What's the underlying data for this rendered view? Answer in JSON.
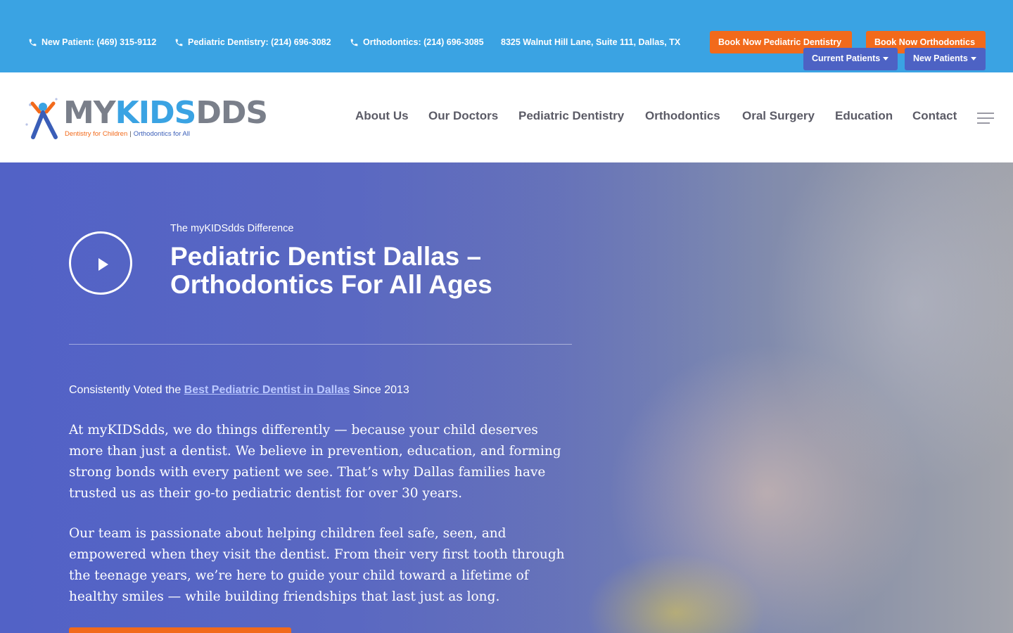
{
  "topbar": {
    "contacts": [
      {
        "icon": "phone-icon",
        "text": "New Patient: (469) 315-9112"
      },
      {
        "icon": "phone-icon",
        "text": "Pediatric Dentistry: (214) 696-3082"
      },
      {
        "icon": "phone-icon",
        "text": "Orthodontics: (214) 696-3085"
      },
      {
        "text": "8325 Walnut Hill Lane, Suite 111, Dallas, TX"
      }
    ],
    "book_pediatric": "Book Now Pediatric Dentistry",
    "book_ortho": "Book Now Orthodontics",
    "current_patients": "Current Patients",
    "new_patients": "New Patients",
    "colors": {
      "bar": "#3aa3e3",
      "orange": "#f26a1b",
      "purple": "#4d62c4"
    }
  },
  "logo": {
    "my": "MY",
    "kids": "KIDS",
    "dds": "DDS",
    "tag_left": "Dentistry for Children",
    "tag_sep": "|",
    "tag_right": "Orthodontics for All"
  },
  "nav": {
    "items": [
      "About Us",
      "Our Doctors",
      "Pediatric Dentistry",
      "Orthodontics",
      "Oral Surgery",
      "Education",
      "Contact"
    ],
    "menu_icon": "hamburger-menu-icon"
  },
  "hero": {
    "play_icon": "play-icon",
    "eyebrow": "The myKIDSdds Difference",
    "title": "Pediatric Dentist Dallas – Orthodontics For All Ages",
    "voted_prefix": "Consistently Voted the ",
    "voted_link": "Best Pediatric Dentist in Dallas",
    "voted_suffix": " Since 2013",
    "paragraph1": "At myKIDSdds, we do things differently — because your child deserves more than just a dentist. We believe in prevention, education, and forming strong bonds with every patient we see. That’s why Dallas families have trusted us as their go-to pediatric dentist for over 30 years.",
    "paragraph2": "Our team is passionate about helping children feel safe, seen, and empowered when they visit the dentist. From their very first tooth through the teenage years, we’re here to guide your child toward a lifetime of healthy smiles — while building friendships that last just as long."
  }
}
